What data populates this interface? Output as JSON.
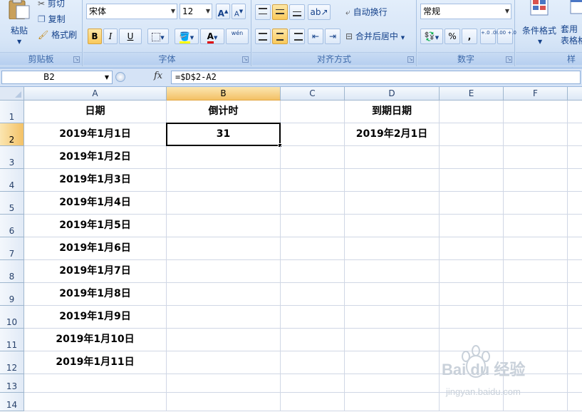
{
  "ribbon": {
    "clipboard": {
      "paste": "粘贴",
      "cut": "剪切",
      "copy": "复制",
      "format_painter": "格式刷",
      "label": "剪贴板"
    },
    "font": {
      "name": "宋体",
      "size": "12",
      "bold": "B",
      "italic": "I",
      "underline": "U",
      "font_color_glyph": "A",
      "phonetic": "wén",
      "label": "字体"
    },
    "alignment": {
      "wrap_text": "自动换行",
      "merge_center": "合并后居中",
      "label": "对齐方式"
    },
    "number": {
      "format": "常规",
      "percent": "%",
      "comma": ",",
      "inc_decimal": "+.0 .00",
      "dec_decimal": ".00 +.0",
      "label": "数字"
    },
    "styles": {
      "conditional": "条件格式",
      "table_format": "套用\n表格格",
      "label": "样式"
    }
  },
  "formula_bar": {
    "name_box": "B2",
    "fx": "fx",
    "formula": "=$D$2-A2"
  },
  "grid": {
    "columns": [
      "A",
      "B",
      "C",
      "D",
      "E",
      "F"
    ],
    "rows": [
      "1",
      "2",
      "3",
      "4",
      "5",
      "6",
      "7",
      "8",
      "9",
      "10",
      "11",
      "12",
      "13",
      "14"
    ],
    "selected_column": "B",
    "selected_row": "2",
    "cells": {
      "A1": "日期",
      "B1": "倒计时",
      "D1": "到期日期",
      "A2": "2019年1月1日",
      "B2": "31",
      "D2": "2019年2月1日",
      "A3": "2019年1月2日",
      "A4": "2019年1月3日",
      "A5": "2019年1月4日",
      "A6": "2019年1月5日",
      "A7": "2019年1月6日",
      "A8": "2019年1月7日",
      "A9": "2019年1月8日",
      "A10": "2019年1月9日",
      "A11": "2019年1月10日",
      "A12": "2019年1月11日"
    }
  },
  "watermark": {
    "brand": "Bai du 经验",
    "url": "jingyan.baidu.com"
  }
}
